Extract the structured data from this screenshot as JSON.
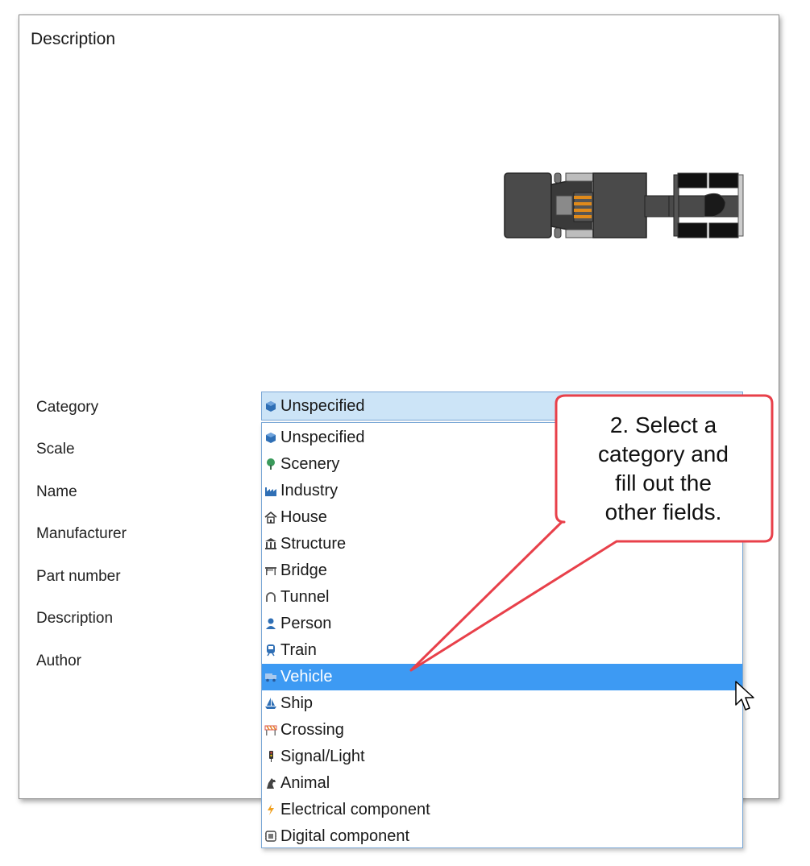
{
  "panel": {
    "title": "Description"
  },
  "fields": {
    "category": "Category",
    "scale": "Scale",
    "name": "Name",
    "manufacturer": "Manufacturer",
    "part_number": "Part number",
    "description": "Description",
    "author": "Author"
  },
  "combo": {
    "selected": "Unspecified",
    "icon": "unspecified-icon"
  },
  "options": [
    {
      "label": "Unspecified",
      "icon": "unspecified-icon"
    },
    {
      "label": "Scenery",
      "icon": "tree-icon"
    },
    {
      "label": "Industry",
      "icon": "factory-icon"
    },
    {
      "label": "House",
      "icon": "house-icon"
    },
    {
      "label": "Structure",
      "icon": "building-icon"
    },
    {
      "label": "Bridge",
      "icon": "bridge-icon"
    },
    {
      "label": "Tunnel",
      "icon": "tunnel-icon"
    },
    {
      "label": "Person",
      "icon": "person-icon"
    },
    {
      "label": "Train",
      "icon": "train-icon"
    },
    {
      "label": "Vehicle",
      "icon": "truck-icon",
      "selected": true
    },
    {
      "label": "Ship",
      "icon": "sailboat-icon"
    },
    {
      "label": "Crossing",
      "icon": "barrier-icon"
    },
    {
      "label": "Signal/Light",
      "icon": "signal-light-icon"
    },
    {
      "label": "Animal",
      "icon": "horse-icon"
    },
    {
      "label": "Electrical component",
      "icon": "lightning-icon"
    },
    {
      "label": "Digital component",
      "icon": "chip-icon"
    }
  ],
  "callout": {
    "line1": "2. Select a",
    "line2": "category and",
    "line3": "fill out the",
    "line4": "other fields."
  },
  "colors": {
    "selection": "#3d9af3",
    "combo_bg": "#cce4f7",
    "callout_border": "#e8404a",
    "icon_blue": "#2f6fb5"
  }
}
